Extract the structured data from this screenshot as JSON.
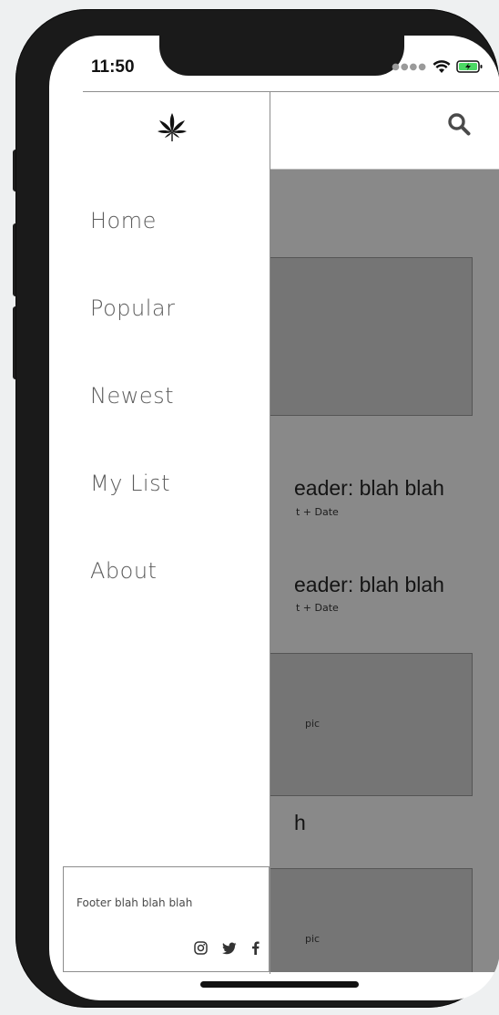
{
  "status": {
    "time": "11:50"
  },
  "drawer": {
    "items": [
      {
        "label": "Home"
      },
      {
        "label": "Popular"
      },
      {
        "label": "Newest"
      },
      {
        "label": "My List"
      },
      {
        "label": "About"
      }
    ],
    "footer_text": "Footer blah blah blah",
    "socials": [
      "instagram-icon",
      "twitter-icon",
      "facebook-icon"
    ]
  },
  "content": {
    "headline_1": "eader: blah blah",
    "byline_1": "t + Date",
    "headline_2": "eader: blah blah",
    "byline_2": "t + Date",
    "pic_label_1": "pic",
    "headline_3": "h",
    "pic_label_2": "pic"
  },
  "colors": {
    "overlay": "#898989",
    "card": "#757575",
    "phone_frame": "#1a1a1a",
    "nav_text": "#5c5c5c"
  }
}
